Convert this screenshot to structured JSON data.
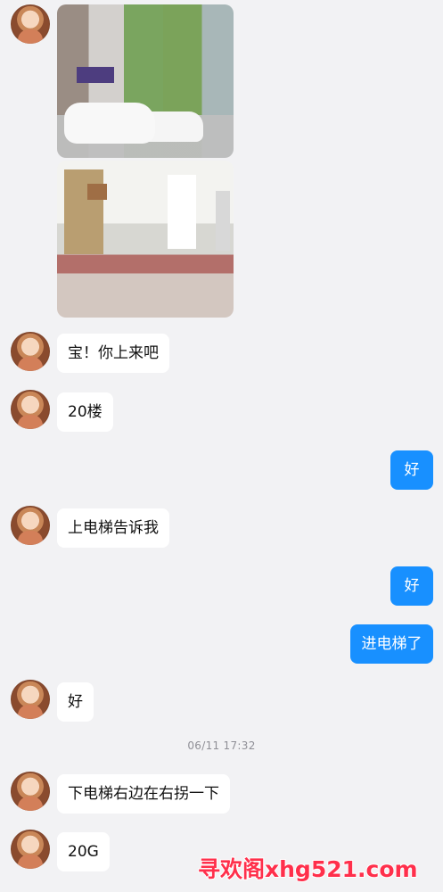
{
  "messages": [
    {
      "type": "image_group",
      "side": "left"
    },
    {
      "type": "text",
      "side": "left",
      "text": "宝！你上来吧"
    },
    {
      "type": "text",
      "side": "left",
      "text": "20楼"
    },
    {
      "type": "text",
      "side": "right",
      "text": "好"
    },
    {
      "type": "text",
      "side": "left",
      "text": "上电梯告诉我"
    },
    {
      "type": "text",
      "side": "right",
      "text": "好"
    },
    {
      "type": "text",
      "side": "right",
      "text": "进电梯了"
    },
    {
      "type": "text",
      "side": "left",
      "text": "好"
    },
    {
      "type": "timestamp",
      "text": "06/11 17:32"
    },
    {
      "type": "text",
      "side": "left",
      "text": "下电梯右边在右拐一下"
    },
    {
      "type": "text",
      "side": "left",
      "text": "20G"
    }
  ],
  "watermark": {
    "text": "寻欢阁xhg521.com"
  },
  "colors": {
    "background": "#f2f2f4",
    "incoming_bubble": "#ffffff",
    "outgoing_bubble": "#1890ff",
    "timestamp": "#8f8f96",
    "watermark": "#ff2f4b"
  }
}
